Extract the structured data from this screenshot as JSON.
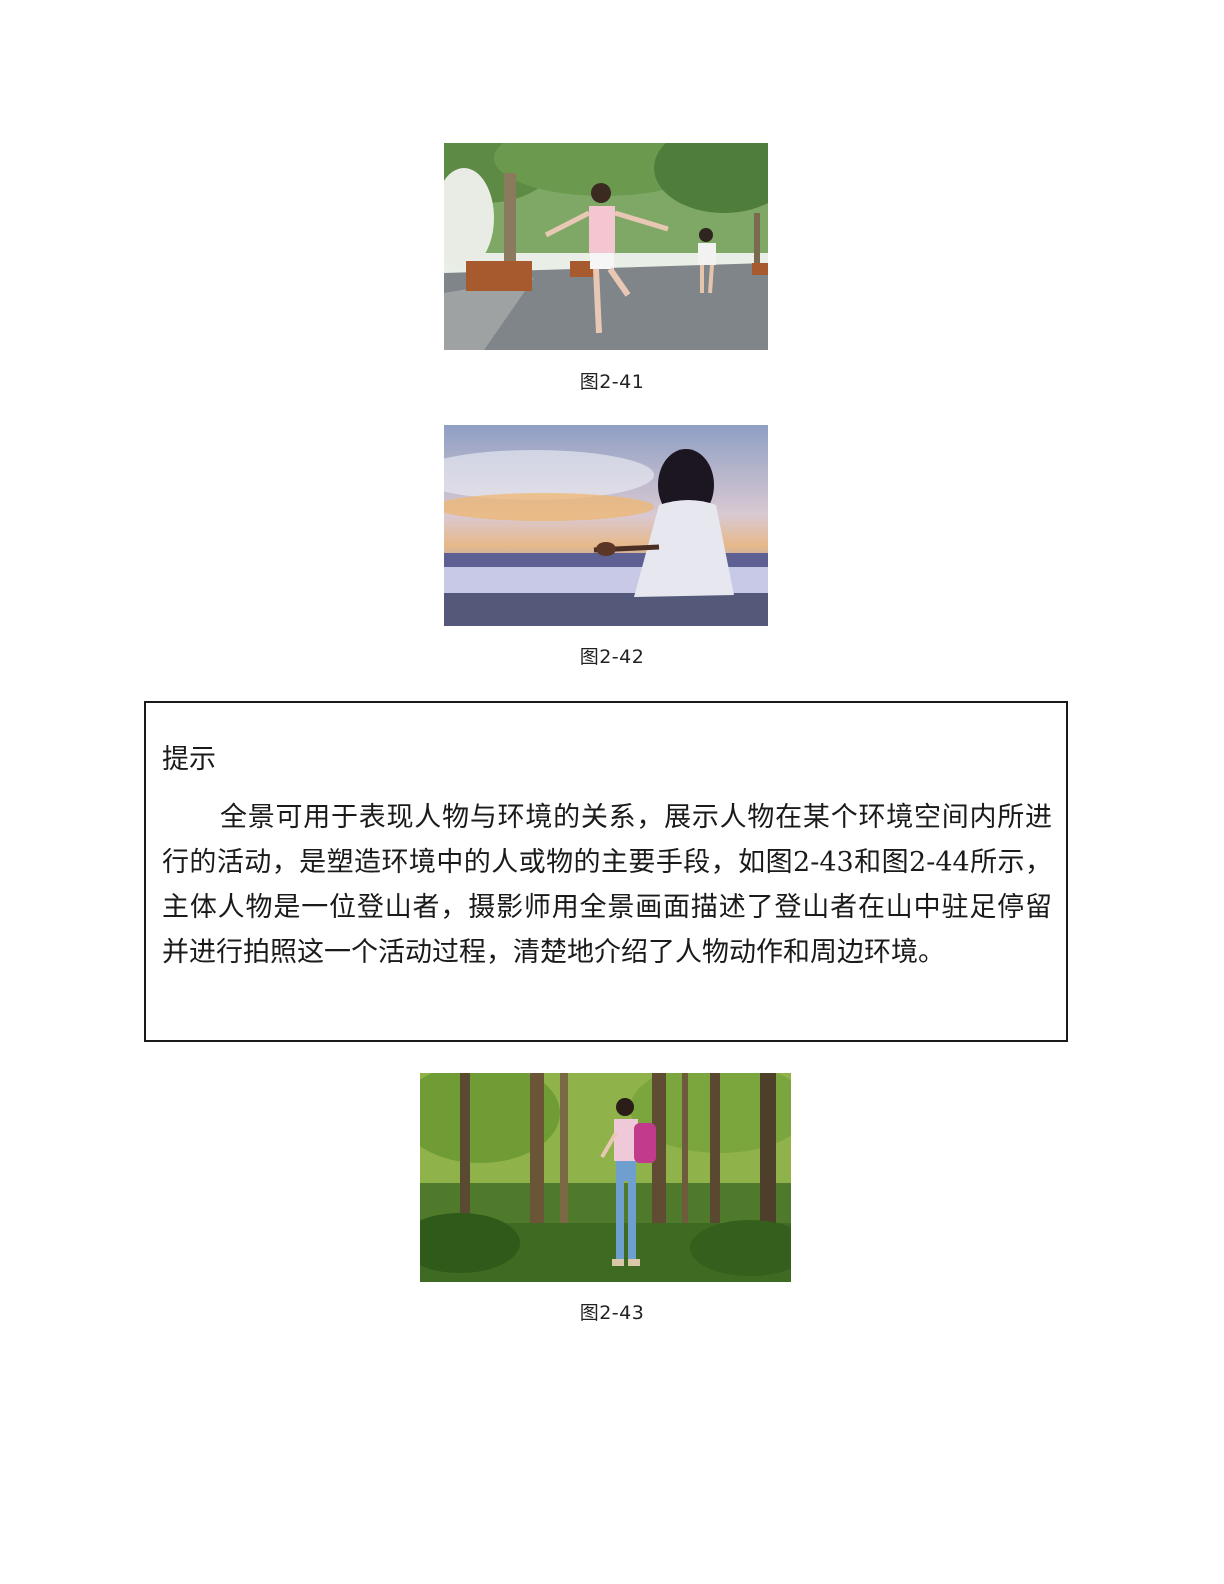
{
  "figures": [
    {
      "caption": "图2-41"
    },
    {
      "caption": "图2-42"
    },
    {
      "caption": "图2-43"
    }
  ],
  "tip": {
    "title": "提示",
    "body": "全景可用于表现人物与环境的关系，展示人物在某个环境空间内所进行的活动，是塑造环境中的人或物的主要手段，如图2-43和图2-44所示，主体人物是一位登山者，摄影师用全景画面描述了登山者在山中驻足停留并进行拍照这一个活动过程，清楚地介绍了人物动作和周边环境。"
  }
}
